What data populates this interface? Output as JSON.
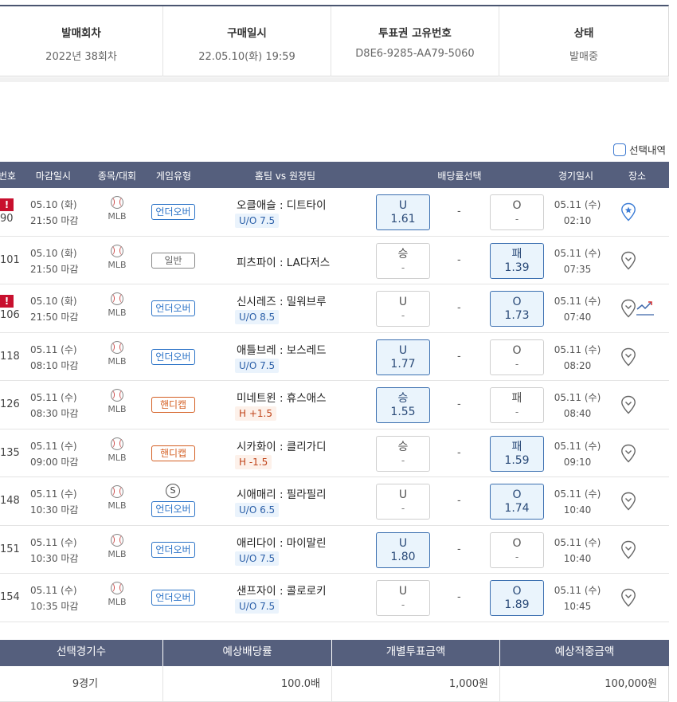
{
  "info": {
    "cols": [
      {
        "header": "발매회차",
        "value": "2022년 38회차"
      },
      {
        "header": "구매일시",
        "value": "22.05.10(화) 19:59"
      },
      {
        "header": "투표권 고유번호",
        "value": "D8E6-9285-AA79-5060"
      },
      {
        "header": "상태",
        "value": "발매중"
      }
    ]
  },
  "select_history": {
    "label": "선택내역"
  },
  "table": {
    "headers": {
      "no": "번호",
      "deadline": "마감일시",
      "sport": "종목/대회",
      "type": "게임유형",
      "teams": "홈팀 vs 원정팀",
      "odds": "배당률선택",
      "game_time": "경기일시",
      "venue": "장소"
    },
    "rows": [
      {
        "no": "90",
        "alert": "!",
        "deadline_date": "05.10 (화)",
        "deadline_time": "21:50 마감",
        "league": "MLB",
        "type": "언더오버",
        "teams": "오클애슬 : 디트타이",
        "line": "U/O 7.5",
        "left_key": "U",
        "left_odds": "1.61",
        "mid": "-",
        "right_key": "O",
        "right_odds": "-",
        "game_date": "05.11 (수)",
        "game_time": "02:10"
      },
      {
        "no": "101",
        "deadline_date": "05.10 (화)",
        "deadline_time": "21:50 마감",
        "league": "MLB",
        "type": "일반",
        "teams": "피츠파이 : LA다저스",
        "line": "",
        "left_key": "승",
        "left_odds": "-",
        "mid": "-",
        "right_key": "패",
        "right_odds": "1.39",
        "game_date": "05.11 (수)",
        "game_time": "07:35"
      },
      {
        "no": "106",
        "alert": "!",
        "deadline_date": "05.10 (화)",
        "deadline_time": "21:50 마감",
        "league": "MLB",
        "type": "언더오버",
        "teams": "신시레즈 : 밀워브루",
        "line": "U/O 8.5",
        "left_key": "U",
        "left_odds": "-",
        "mid": "-",
        "right_key": "O",
        "right_odds": "1.73",
        "game_date": "05.11 (수)",
        "game_time": "07:40"
      },
      {
        "no": "118",
        "deadline_date": "05.11 (수)",
        "deadline_time": "08:10 마감",
        "league": "MLB",
        "type": "언더오버",
        "teams": "애틀브레 : 보스레드",
        "line": "U/O 7.5",
        "left_key": "U",
        "left_odds": "1.77",
        "mid": "-",
        "right_key": "O",
        "right_odds": "-",
        "game_date": "05.11 (수)",
        "game_time": "08:20"
      },
      {
        "no": "126",
        "deadline_date": "05.11 (수)",
        "deadline_time": "08:30 마감",
        "league": "MLB",
        "type": "핸디캡",
        "teams": "미네트윈 : 휴스애스",
        "line": "H +1.5",
        "left_key": "승",
        "left_odds": "1.55",
        "mid": "-",
        "right_key": "패",
        "right_odds": "-",
        "game_date": "05.11 (수)",
        "game_time": "08:40"
      },
      {
        "no": "135",
        "deadline_date": "05.11 (수)",
        "deadline_time": "09:00 마감",
        "league": "MLB",
        "type": "핸디캡",
        "teams": "시카화이 : 클리가디",
        "line": "H -1.5",
        "left_key": "승",
        "left_odds": "-",
        "mid": "-",
        "right_key": "패",
        "right_odds": "1.59",
        "game_date": "05.11 (수)",
        "game_time": "09:10"
      },
      {
        "no": "148",
        "badge": "S",
        "deadline_date": "05.11 (수)",
        "deadline_time": "10:30 마감",
        "league": "MLB",
        "type": "언더오버",
        "teams": "시애매리 : 필라필리",
        "line": "U/O 6.5",
        "left_key": "U",
        "left_odds": "-",
        "mid": "-",
        "right_key": "O",
        "right_odds": "1.74",
        "game_date": "05.11 (수)",
        "game_time": "10:40"
      },
      {
        "no": "151",
        "deadline_date": "05.11 (수)",
        "deadline_time": "10:30 마감",
        "league": "MLB",
        "type": "언더오버",
        "teams": "애리다이 : 마이말린",
        "line": "U/O 7.5",
        "left_key": "U",
        "left_odds": "1.80",
        "mid": "-",
        "right_key": "O",
        "right_odds": "-",
        "game_date": "05.11 (수)",
        "game_time": "10:40"
      },
      {
        "no": "154",
        "deadline_date": "05.11 (수)",
        "deadline_time": "10:35 마감",
        "league": "MLB",
        "type": "언더오버",
        "teams": "샌프자이 : 콜로로키",
        "line": "U/O 7.5",
        "left_key": "U",
        "left_odds": "-",
        "mid": "-",
        "right_key": "O",
        "right_odds": "1.89",
        "game_date": "05.11 (수)",
        "game_time": "10:45"
      }
    ]
  },
  "summary": {
    "cols": [
      {
        "header": "선택경기수",
        "value": "9경기"
      },
      {
        "header": "예상배당률",
        "value": "100.0배"
      },
      {
        "header": "개별투표금액",
        "value": "1,000원"
      },
      {
        "header": "예상적중금액",
        "value": "100,000원"
      }
    ]
  },
  "colors": {
    "header_bg": "#555f7d",
    "selected_border": "#3b6fb0",
    "selected_bg": "#eaf4fc",
    "alert": "#c8102e",
    "over_under": "#2b73c7",
    "handicap": "#d45f23"
  },
  "icons": {
    "venue": "map-pin-icon",
    "trend": "line-chart-icon",
    "sport": "baseball-icon"
  }
}
